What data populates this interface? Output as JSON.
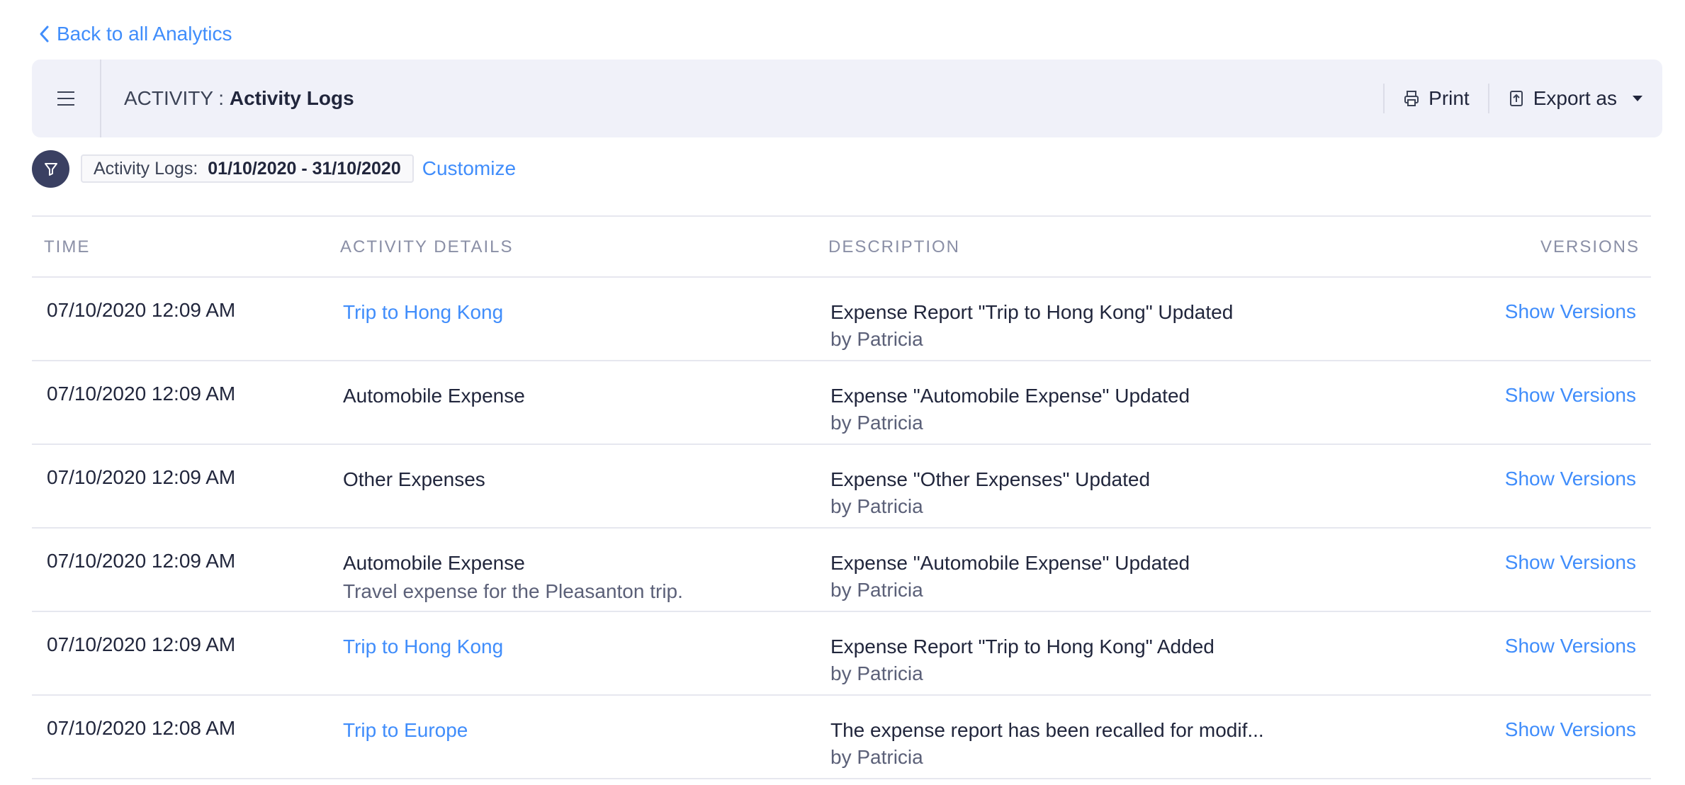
{
  "back_link": {
    "label": "Back to all Analytics"
  },
  "header": {
    "section": "ACTIVITY :",
    "title": "Activity Logs",
    "print_label": "Print",
    "export_label": "Export as"
  },
  "filter": {
    "label": "Activity Logs:",
    "value": "01/10/2020 - 31/10/2020",
    "customize_label": "Customize"
  },
  "table": {
    "columns": {
      "time": "TIME",
      "activity": "ACTIVITY DETAILS",
      "description": "DESCRIPTION",
      "versions": "VERSIONS"
    },
    "rows": [
      {
        "time": "07/10/2020 12:09 AM",
        "activity": "Trip to Hong Kong",
        "activity_sub": "",
        "activity_is_link": true,
        "description": "Expense Report \"Trip to Hong Kong\" Updated",
        "by": "by Patricia",
        "versions": "Show Versions"
      },
      {
        "time": "07/10/2020 12:09 AM",
        "activity": "Automobile Expense",
        "activity_sub": "",
        "activity_is_link": false,
        "description": "Expense \"Automobile Expense\" Updated",
        "by": "by Patricia",
        "versions": "Show Versions"
      },
      {
        "time": "07/10/2020 12:09 AM",
        "activity": "Other Expenses",
        "activity_sub": "",
        "activity_is_link": false,
        "description": "Expense \"Other Expenses\" Updated",
        "by": "by Patricia",
        "versions": "Show Versions"
      },
      {
        "time": "07/10/2020 12:09 AM",
        "activity": "Automobile Expense",
        "activity_sub": "Travel expense for the Pleasanton trip.",
        "activity_is_link": false,
        "description": "Expense \"Automobile Expense\" Updated",
        "by": "by Patricia",
        "versions": "Show Versions"
      },
      {
        "time": "07/10/2020 12:09 AM",
        "activity": "Trip to Hong Kong",
        "activity_sub": "",
        "activity_is_link": true,
        "description": "Expense Report \"Trip to Hong Kong\" Added",
        "by": "by Patricia",
        "versions": "Show Versions"
      },
      {
        "time": "07/10/2020 12:08 AM",
        "activity": "Trip to Europe",
        "activity_sub": "",
        "activity_is_link": true,
        "description": "The expense report has been recalled for modif...",
        "by": "by Patricia",
        "versions": "Show Versions"
      }
    ]
  },
  "icons": {
    "back": "chevron-left-icon",
    "menu": "hamburger-menu-icon",
    "print": "printer-icon",
    "export": "export-upload-icon",
    "caret": "caret-down-icon",
    "filter": "funnel-filter-icon"
  },
  "colors": {
    "link": "#408dfb",
    "header_bg": "#f0f1f9",
    "filter_circle": "#3a4062",
    "text": "#21263c",
    "muted": "#8a8fa6"
  }
}
